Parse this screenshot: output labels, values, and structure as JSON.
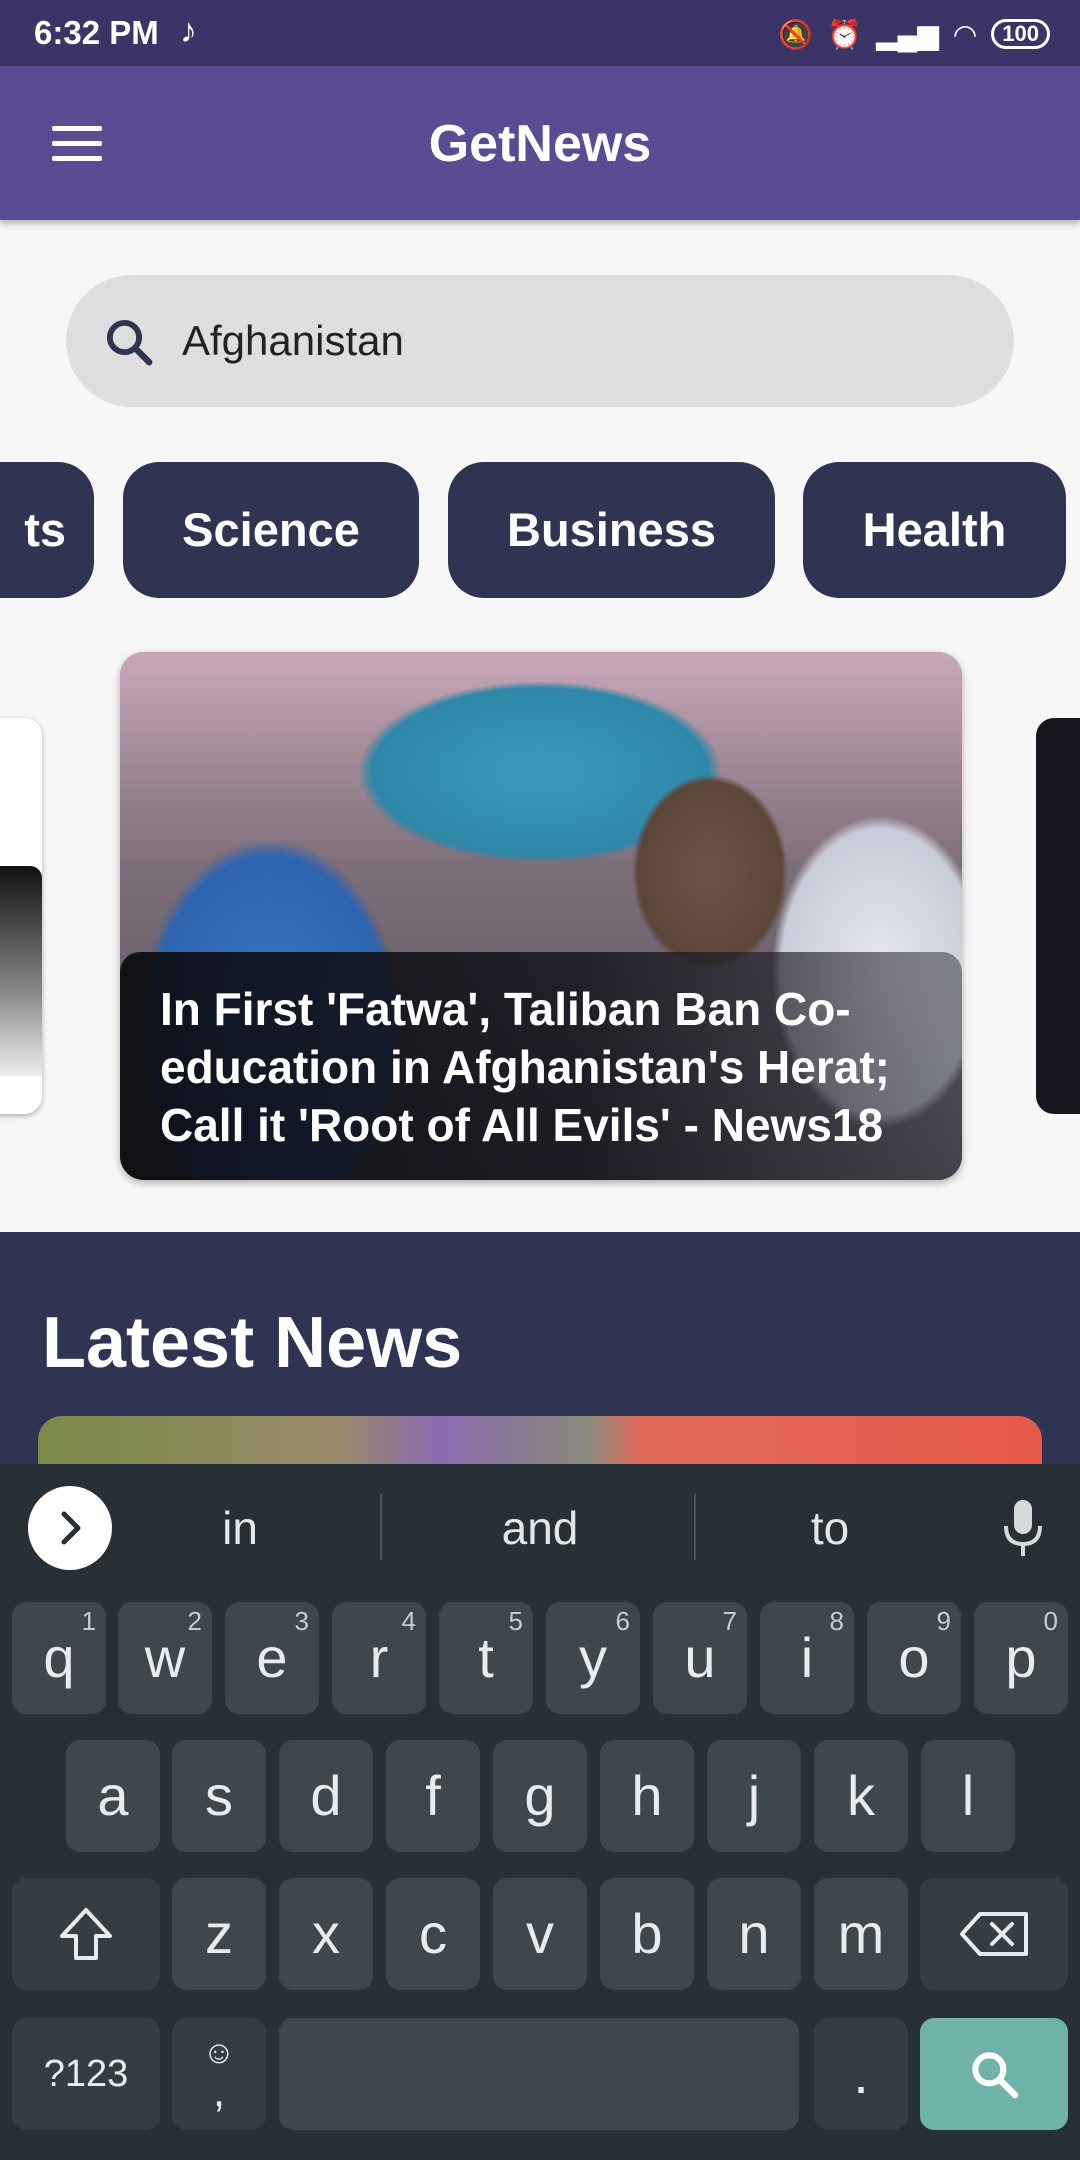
{
  "status_bar": {
    "time": "6:32 PM",
    "battery": "100"
  },
  "app_bar": {
    "title": "GetNews"
  },
  "search": {
    "query": "Afghanistan"
  },
  "categories": [
    {
      "label": "ts"
    },
    {
      "label": "Science"
    },
    {
      "label": "Business"
    },
    {
      "label": "Health"
    }
  ],
  "carousel": {
    "headline": "In First 'Fatwa', Taliban Ban Co-education in Afghanistan's Herat; Call it 'Root of All Evils' - News18"
  },
  "latest": {
    "title": "Latest News"
  },
  "keyboard": {
    "suggestions": [
      "in",
      "and",
      "to"
    ],
    "row1": [
      {
        "k": "q",
        "h": "1"
      },
      {
        "k": "w",
        "h": "2"
      },
      {
        "k": "e",
        "h": "3"
      },
      {
        "k": "r",
        "h": "4"
      },
      {
        "k": "t",
        "h": "5"
      },
      {
        "k": "y",
        "h": "6"
      },
      {
        "k": "u",
        "h": "7"
      },
      {
        "k": "i",
        "h": "8"
      },
      {
        "k": "o",
        "h": "9"
      },
      {
        "k": "p",
        "h": "0"
      }
    ],
    "row2": [
      "a",
      "s",
      "d",
      "f",
      "g",
      "h",
      "j",
      "k",
      "l"
    ],
    "row3": [
      "z",
      "x",
      "c",
      "v",
      "b",
      "n",
      "m"
    ],
    "symbols": "?123",
    "emoji_comma": ",",
    "period": "."
  }
}
